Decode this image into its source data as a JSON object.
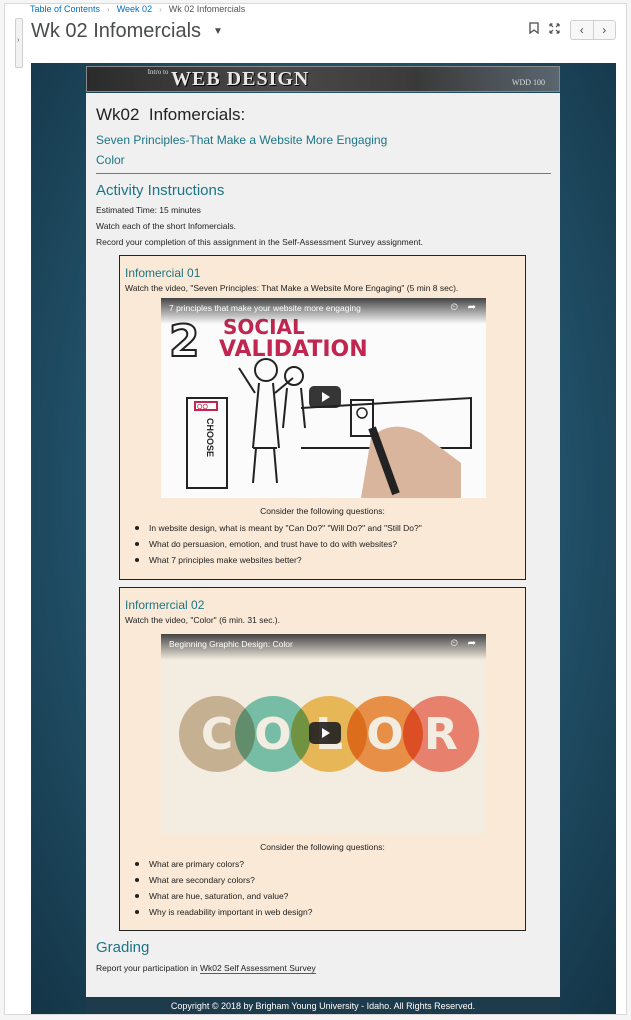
{
  "breadcrumb": {
    "items": [
      "Table of Contents",
      "Week 02",
      "Wk 02 Infomercials"
    ]
  },
  "page": {
    "title": "Wk 02 Infomercials"
  },
  "banner": {
    "intro": "Intro to",
    "title": "WEB DESIGN",
    "code": "WDD 100"
  },
  "heading": "Wk02  Infomercials:",
  "subtitles": [
    "Seven Principles-That Make a Website More Engaging",
    "Color"
  ],
  "activity": {
    "heading": "Activity Instructions",
    "lines": [
      "Estimated Time: 15 minutes",
      "Watch each of the short Infomercials.",
      "Record your completion of this assignment in the Self-Assessment Survey assignment."
    ]
  },
  "infomercials": [
    {
      "heading": "Infomercial 01",
      "desc": "Watch the video, \"Seven Principles: That Make a Website More Engaging\" (5 min 8 sec).",
      "video_title": "7 principles that make your website more engaging",
      "video_text": {
        "num": "2",
        "line1": "SOCIAL",
        "line2": "VALIDATION",
        "door": "CHOOSE",
        "badge": "OO"
      },
      "consider": "Consider the following questions:",
      "questions": [
        "In website design, what is meant by \"Can Do?\" \"Will Do?\" and \"Still Do?\"",
        "What do persuasion, emotion, and trust have to do with websites?",
        "What 7 principles make websites better?"
      ]
    },
    {
      "heading": "Informercial 02",
      "desc": "Watch the video, \"Color\" (6 min. 31 sec.).",
      "video_title": "Beginning Graphic Design: Color",
      "video_letters": [
        "C",
        "O",
        "L",
        "O",
        "R"
      ],
      "circle_colors": [
        "#cbb79c",
        "#6fc7b5",
        "#f2bf52",
        "#f28e3e",
        "#f27e6e"
      ],
      "consider": "Consider the following questions:",
      "questions": [
        "What are primary colors?",
        "What are secondary colors?",
        "What are hue, saturation, and value?",
        "Why is readability important in web design?"
      ]
    }
  ],
  "grading": {
    "heading": "Grading",
    "text": "Report your participation in ",
    "link": "Wk02 Self Assessment Survey"
  },
  "footer": "Copyright © 2018 by Brigham Young University - Idaho. All Rights Reserved."
}
